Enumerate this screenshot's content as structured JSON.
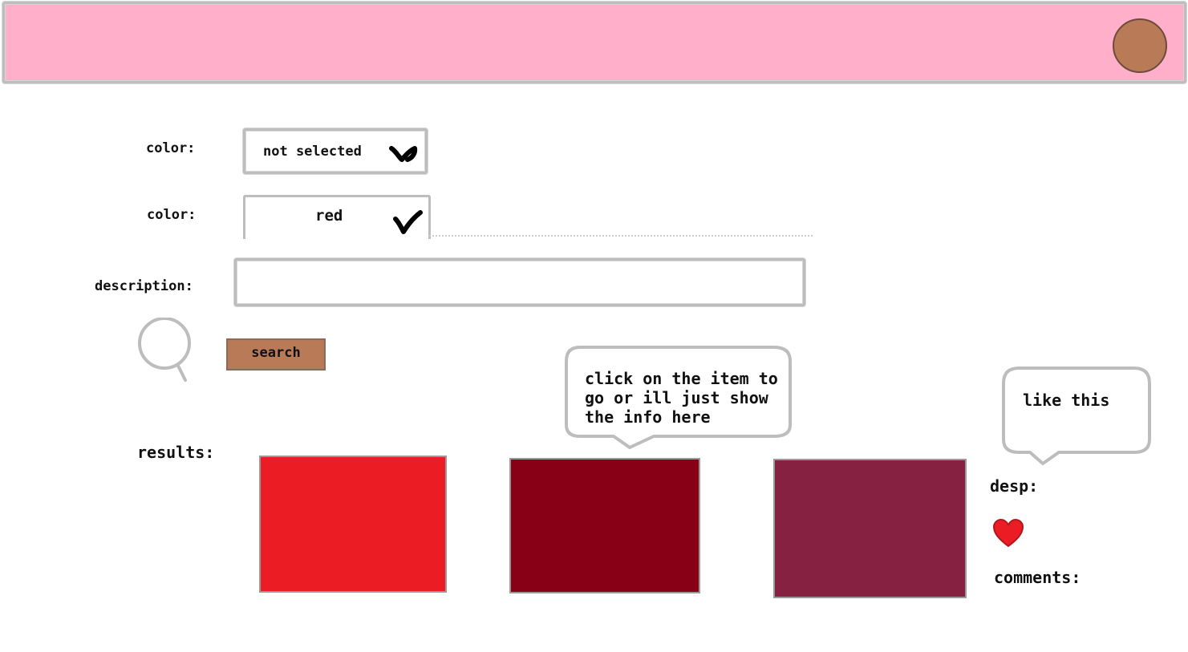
{
  "colors": {
    "header_bg": "#ffafc9",
    "avatar": "#b97a57",
    "search_button": "#b97a57",
    "result_1": "#ec1c24",
    "result_2": "#880015",
    "result_3": "#872142",
    "heart": "#ec1c24"
  },
  "header": {
    "avatar_icon": "avatar-icon"
  },
  "filters": {
    "color_1": {
      "label": "color:",
      "value": "not selected",
      "icon": "chevron-down-icon"
    },
    "color_2": {
      "label": "color:",
      "value": "red",
      "icon": "checkmark-icon"
    },
    "description": {
      "label": "description:",
      "value": "",
      "placeholder": ""
    }
  },
  "search": {
    "icon": "search-icon",
    "button_label": "search"
  },
  "bubbles": {
    "item_hint": "click on the item to\ngo or ill just show\nthe info here",
    "like_hint": "like this"
  },
  "results": {
    "label": "results:",
    "items": [
      {
        "color": "#ec1c24"
      },
      {
        "color": "#880015"
      },
      {
        "color": "#872142"
      }
    ]
  },
  "details": {
    "desp_label": "desp:",
    "like_icon": "heart-icon",
    "comments_label": "comments:"
  }
}
